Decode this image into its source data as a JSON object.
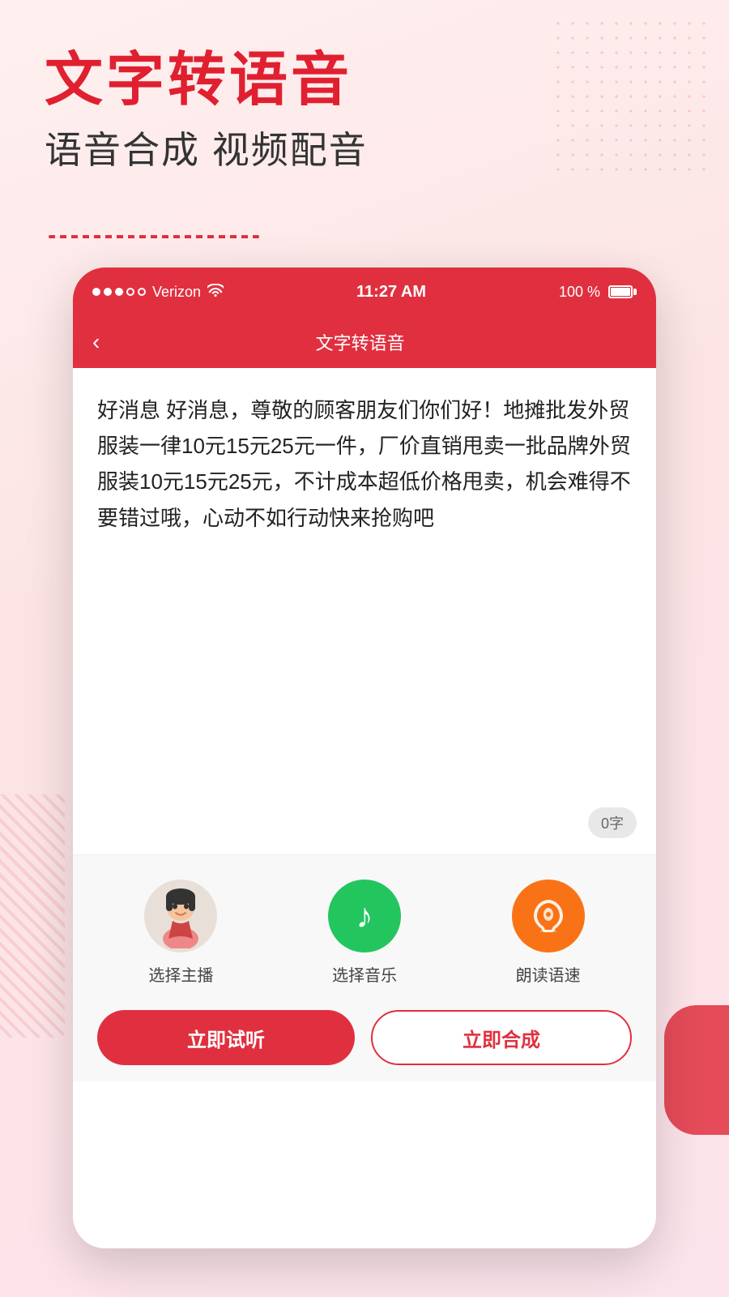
{
  "background": {
    "color": "#fce4e4"
  },
  "header": {
    "main_title": "文字转语音",
    "sub_title": "语音合成 视频配音"
  },
  "status_bar": {
    "signal": "●●●○○",
    "carrier": "Verizon",
    "time": "11:27 AM",
    "battery_pct": "100 %"
  },
  "nav": {
    "back_label": "‹",
    "title": "文字转语音"
  },
  "content": {
    "text": "好消息 好消息，尊敬的顾客朋友们你们好！地摊批发外贸服装一律10元15元25元一件，厂价直销甩卖一批品牌外贸服装10元15元25元，不计成本超低价格甩卖，机会难得不要错过哦，心动不如行动快来抢购吧",
    "char_count": "0字"
  },
  "controls": [
    {
      "id": "broadcaster",
      "icon": "avatar",
      "bg": "#e8e0d8",
      "label": "选择主播"
    },
    {
      "id": "music",
      "icon": "♪",
      "bg": "#22c55e",
      "label": "选择音乐"
    },
    {
      "id": "speed",
      "icon": "🚀",
      "bg": "#f97316",
      "label": "朗读语速"
    }
  ],
  "buttons": {
    "listen": "立即试听",
    "synthesize": "立即合成"
  }
}
